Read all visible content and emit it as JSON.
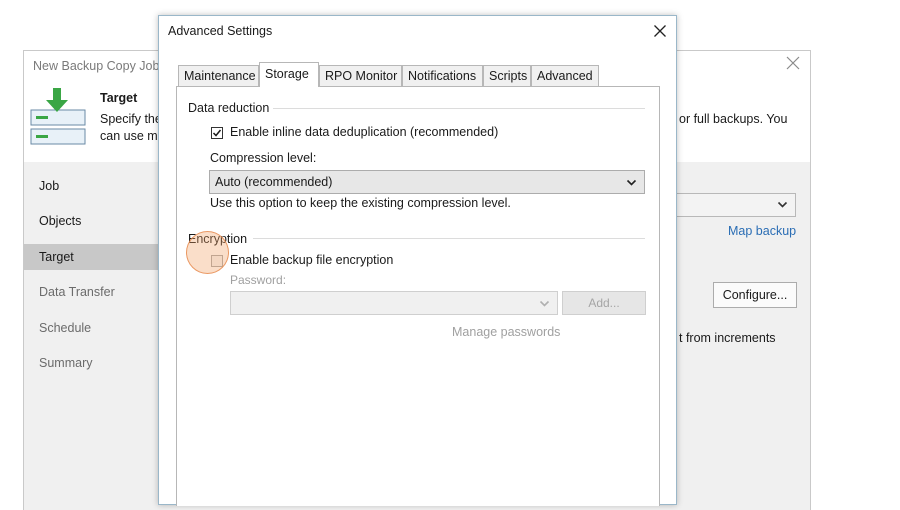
{
  "wizard": {
    "title": "New Backup Copy Job",
    "header": {
      "title": "Target",
      "desc_line1": "Specify the",
      "desc_line2": "can use ma",
      "desc_right": "or full backups. You"
    },
    "nav": [
      "Job",
      "Objects",
      "Target",
      "Data Transfer",
      "Schedule",
      "Summary"
    ],
    "active_nav": "Target",
    "map_backup_link": "Map backup",
    "configure_button": "Configure...",
    "increments_text": "t from increments"
  },
  "dialog": {
    "title": "Advanced Settings",
    "tabs": [
      "Maintenance",
      "Storage",
      "RPO Monitor",
      "Notifications",
      "Scripts",
      "Advanced"
    ],
    "active_tab": "Storage",
    "data_reduction": {
      "group_title": "Data reduction",
      "dedup_label": "Enable inline data deduplication (recommended)",
      "dedup_checked": true,
      "compression_label": "Compression level:",
      "compression_value": "Auto (recommended)",
      "compression_hint": "Use this option to keep the existing compression level."
    },
    "encryption": {
      "group_title": "Encryption",
      "enable_label": "Enable backup file encryption",
      "enable_checked": false,
      "password_label": "Password:",
      "add_button": "Add...",
      "manage_link": "Manage passwords"
    }
  },
  "colors": {
    "accent_link": "#2a6db4",
    "highlight": "#f0a064",
    "nav_active": "#c8c8c8",
    "dialog_border": "#9ab7c9"
  }
}
